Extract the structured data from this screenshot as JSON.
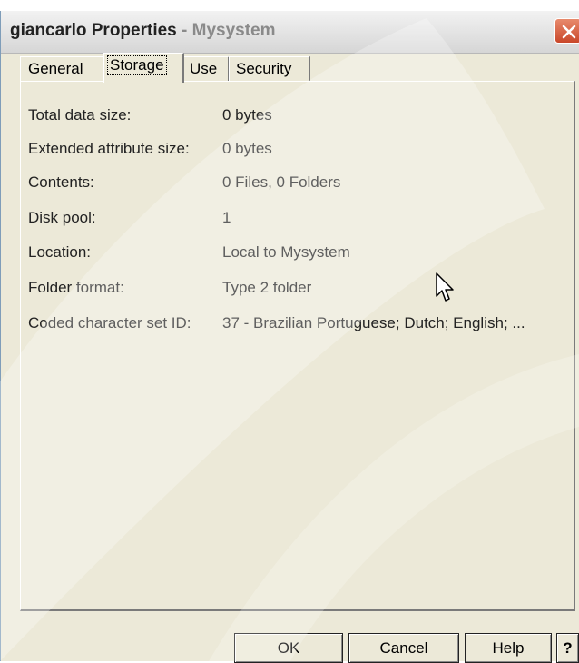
{
  "window": {
    "title_name": "giancarlo Properties",
    "title_sep": " - ",
    "title_system": "Mysystem"
  },
  "tabs": [
    {
      "label": "General"
    },
    {
      "label": "Storage"
    },
    {
      "label": "Use"
    },
    {
      "label": "Security"
    }
  ],
  "active_tab": "Storage",
  "properties": [
    {
      "label": "Total data size:",
      "value": "0 bytes"
    },
    {
      "label": "Extended attribute size:",
      "value": "0 bytes"
    },
    {
      "label": "Contents:",
      "value": "0 Files, 0 Folders"
    },
    {
      "label": "Disk pool:",
      "value": "1"
    },
    {
      "label": "Location:",
      "value": "Local to Mysystem"
    },
    {
      "label": "Folder format:",
      "value": "Type 2 folder"
    },
    {
      "label": "Coded character set ID:",
      "value": "37 - Brazilian Portuguese; Dutch; English; ..."
    }
  ],
  "buttons": {
    "ok": "OK",
    "cancel": "Cancel",
    "help": "Help",
    "context_help": "?"
  },
  "icons": {
    "close": "close-icon",
    "cursor": "mouse-pointer-icon"
  },
  "colors": {
    "window_bg": "#ece9d8",
    "close_button": "#c9472a"
  }
}
